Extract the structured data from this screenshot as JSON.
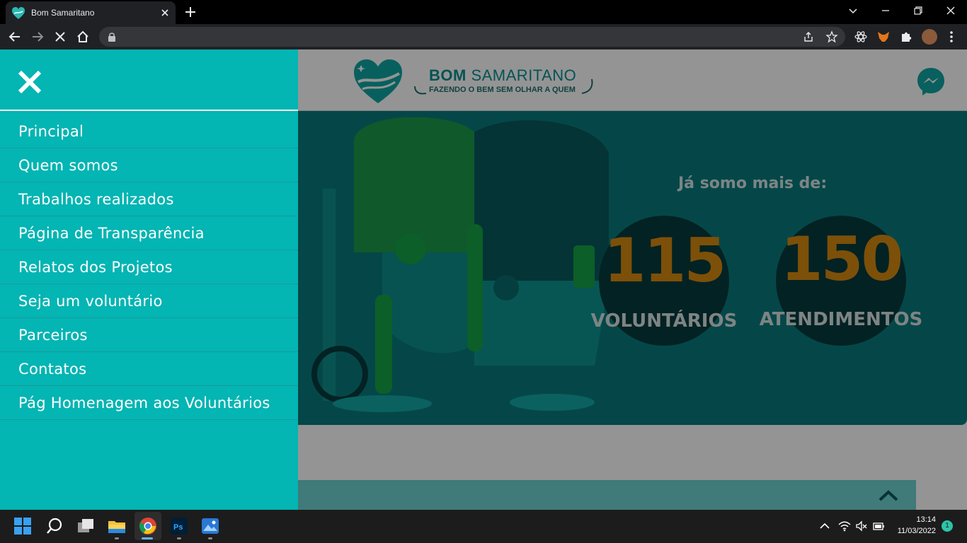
{
  "browser": {
    "tab_title": "Bom Samaritano",
    "url": ""
  },
  "site": {
    "logo_title_bold": "BOM",
    "logo_title_light": "SAMARITANO",
    "logo_tagline": "FAZENDO O BEM SEM OLHAR A QUEM",
    "hero_caption": "Já somo mais de:",
    "stats": [
      {
        "value": "115",
        "label": "VOLUNTÁRIOS"
      },
      {
        "value": "150",
        "label": "ATENDIMENTOS"
      }
    ],
    "accent_color": "#03b5b3",
    "stat_color": "#d68a10"
  },
  "menu": {
    "items": [
      {
        "label": "Principal"
      },
      {
        "label": "Quem somos"
      },
      {
        "label": "Trabalhos realizados"
      },
      {
        "label": "Página de Transparência"
      },
      {
        "label": "Relatos dos Projetos"
      },
      {
        "label": "Seja um voluntário"
      },
      {
        "label": "Parceiros"
      },
      {
        "label": "Contatos"
      },
      {
        "label": "Pág Homenagem aos Voluntários"
      }
    ]
  },
  "taskbar": {
    "time": "13:14",
    "date": "11/03/2022",
    "notification_count": "1"
  }
}
